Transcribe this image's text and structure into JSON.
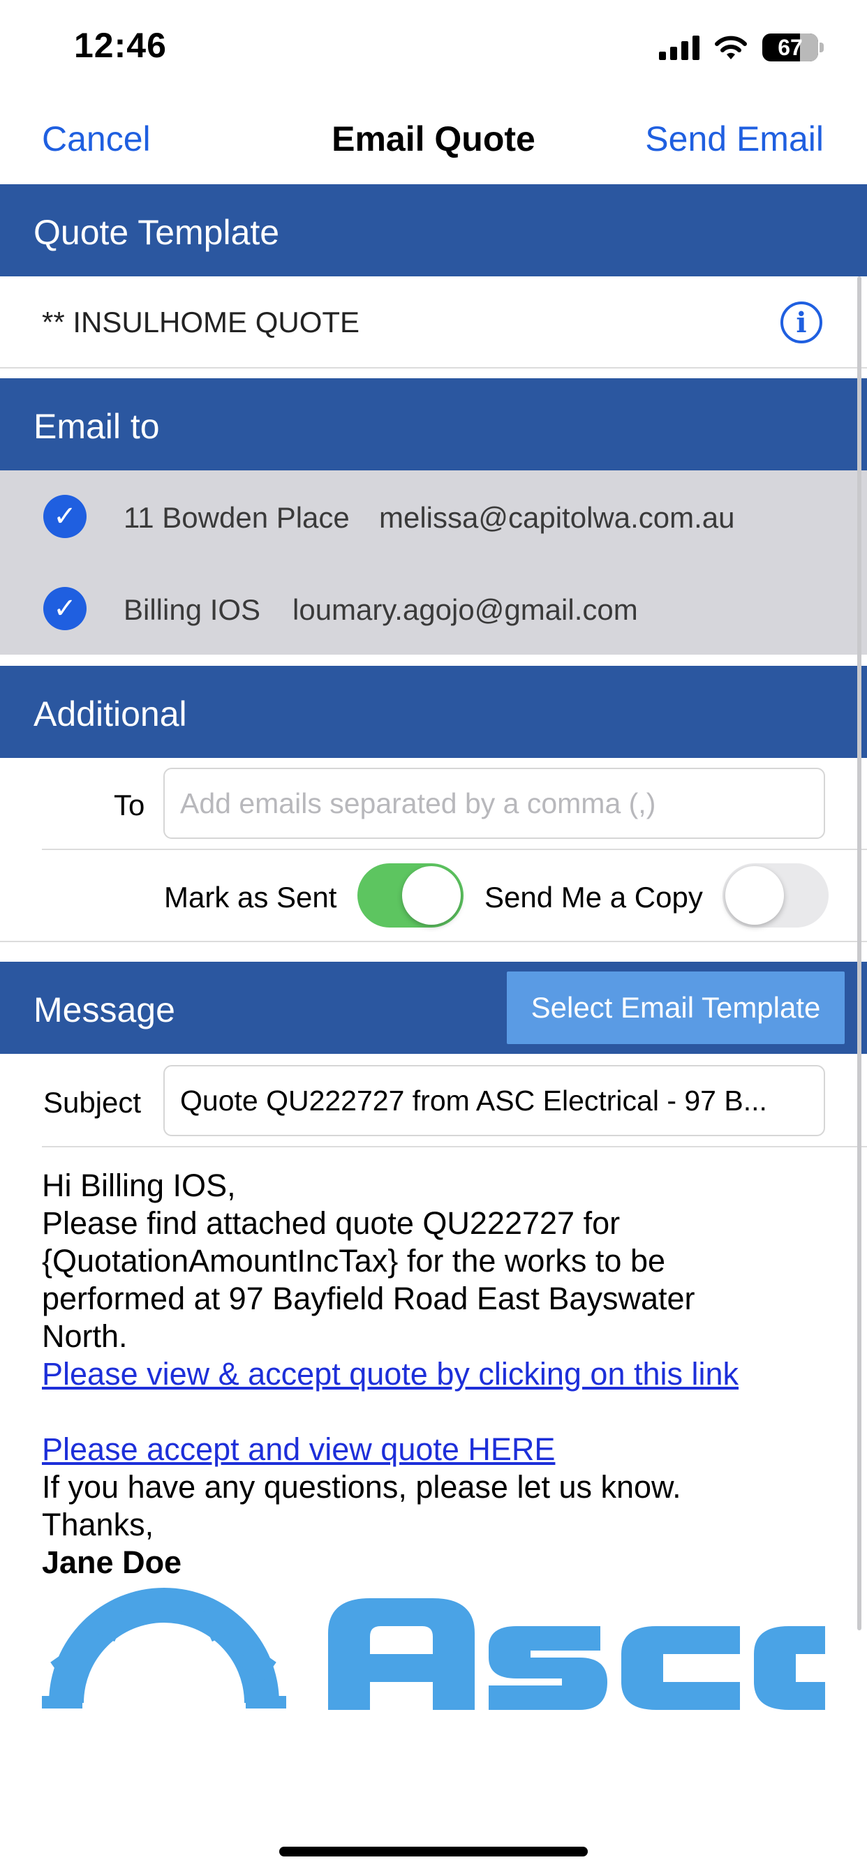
{
  "status_bar": {
    "time": "12:46",
    "battery": "67",
    "icons": [
      "cellular-signal-icon",
      "wifi-icon",
      "battery-icon"
    ]
  },
  "nav": {
    "cancel": "Cancel",
    "title": "Email Quote",
    "send": "Send Email"
  },
  "quote_template": {
    "header": "Quote Template",
    "value": "** INSULHOME QUOTE",
    "info_icon": "i"
  },
  "email_to": {
    "header": "Email to",
    "recipients": [
      {
        "name": "11 Bowden Place",
        "email": "melissa@capitolwa.com.au",
        "checked": true
      },
      {
        "name": "Billing IOS",
        "email": "loumary.agojo@gmail.com",
        "checked": true
      }
    ]
  },
  "additional": {
    "header": "Additional",
    "to_label": "To",
    "to_placeholder": "Add emails separated by a comma (,)",
    "to_value": "",
    "mark_as_sent_label": "Mark as Sent",
    "mark_as_sent": true,
    "send_copy_label": "Send Me a Copy",
    "send_copy": false
  },
  "message": {
    "header": "Message",
    "select_template": "Select Email Template",
    "subject_label": "Subject",
    "subject_value": "Quote QU222727 from ASC Electrical - 97 B...",
    "body": {
      "line1": "Hi Billing IOS,",
      "line2": "Please find attached quote QU222727 for",
      "line3": "{QuotationAmountIncTax} for the works to be",
      "line4": "performed at 97 Bayfield Road East Bayswater",
      "line5": "North.",
      "link1": "Please view & accept quote by clicking on this link",
      "link2": "Please accept and view quote HERE",
      "line6": "If you have any questions, please let us know.",
      "line7": "Thanks,",
      "signature": "Jane Doe"
    },
    "logo_text": "Ascc",
    "logo_color": "#4aa3e6"
  },
  "colors": {
    "header_bg": "#2b57a0",
    "accent": "#1f5fe0",
    "toggle_on": "#5dc560",
    "template_button": "#5a9be4"
  }
}
